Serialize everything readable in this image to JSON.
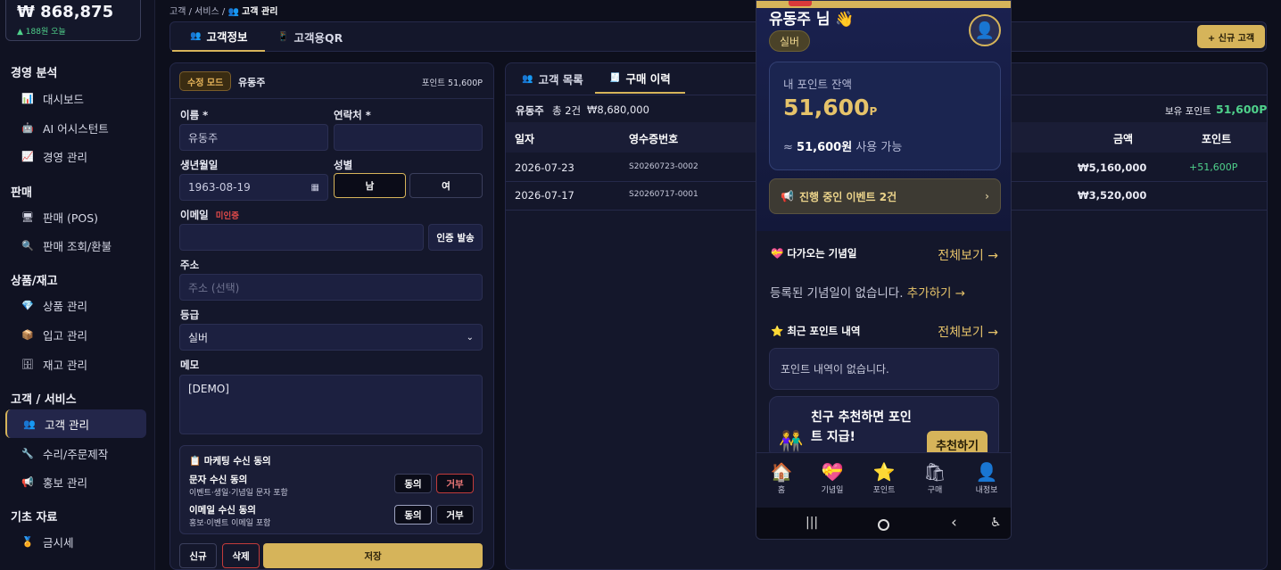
{
  "sidebar": {
    "sales_total": "₩ 868,875",
    "sales_delta": "▲ 188원 오늘",
    "sections": [
      {
        "title": "경영 분석",
        "items": [
          "대시보드",
          "AI 어시스턴트",
          "경영 관리"
        ]
      },
      {
        "title": "판매",
        "items": [
          "판매 (POS)",
          "판매 조회/환불"
        ]
      },
      {
        "title": "상품/재고",
        "items": [
          "상품 관리",
          "입고 관리",
          "재고 관리"
        ]
      },
      {
        "title": "고객 / 서비스",
        "items": [
          "고객 관리",
          "수리/주문제작",
          "홍보 관리"
        ]
      },
      {
        "title": "기초 자료",
        "items": [
          "금시세"
        ]
      }
    ],
    "active_item": "고객 관리"
  },
  "breadcrumb": {
    "parent": "고객 / 서비스 /",
    "current": "고객 관리"
  },
  "main_tabs": [
    "고객정보",
    "고객용QR"
  ],
  "new_customer_label": "+ 신규 고객",
  "form": {
    "mode_badge": "수정 모드",
    "customer_name": "유동주",
    "points_label": "포인트 51,600P",
    "name_label": "이름 *",
    "name_value": "유동주",
    "phone_label": "연락처 *",
    "phone_value": "",
    "birth_label": "생년월일",
    "birth_value": "1963-08-19",
    "gender_label": "성별",
    "gender_male": "남",
    "gender_female": "여",
    "email_label": "이메일",
    "email_status": "미인증",
    "verify_button": "인증 발송",
    "address_label": "주소",
    "address_placeholder": "주소 (선택)",
    "grade_label": "등급",
    "grade_value": "실버",
    "memo_label": "메모",
    "memo_value": "[DEMO]",
    "consent_title": "마케팅 수신 동의",
    "sms_title": "문자 수신 동의",
    "sms_sub": "이벤트·생일·기념일 문자 포함",
    "email_consent_title": "이메일 수신 동의",
    "email_consent_sub": "홍보·이벤트 이메일 포함",
    "agree": "동의",
    "reject": "거부",
    "btn_new": "신규",
    "btn_delete": "삭제",
    "btn_save": "저장"
  },
  "list": {
    "tabs": [
      "고객 목록",
      "구매 이력"
    ],
    "active_tab": "구매 이력",
    "summary_name": "유동주",
    "summary_count": "총 2건",
    "summary_amount": "₩8,680,000",
    "held_points_label": "보유 포인트",
    "held_points_value": "51,600P",
    "columns": [
      "일자",
      "영수증번호",
      "금액",
      "포인트"
    ],
    "rows": [
      {
        "date": "2026-07-23",
        "receipt": "S20260723-0002",
        "amount": "₩5,160,000",
        "points": "+51,600P"
      },
      {
        "date": "2026-07-17",
        "receipt": "S20260717-0001",
        "amount": "₩3,520,000",
        "points": ""
      }
    ]
  },
  "phone": {
    "greeting": "유동주 님 👋",
    "grade": "실버",
    "balance_label": "내 포인트 잔액",
    "balance_value": "51,600",
    "balance_unit": "P",
    "usable_prefix": "≈",
    "usable_value": "51,600원",
    "usable_suffix": "사용 가능",
    "event_text": "진행 중인 이벤트 2건",
    "anniv_title": "다가오는 기념일",
    "see_all": "전체보기 →",
    "anniv_empty": "등록된 기념일이 없습니다.",
    "anniv_add": "추가하기 →",
    "points_title": "최근 포인트 내역",
    "points_empty": "포인트 내역이 없습니다.",
    "referral_line1": "친구 추천하면 포인",
    "referral_line2": "트 지급!",
    "referral_button": "추천하기",
    "nav": [
      "홈",
      "기념일",
      "포인트",
      "구매",
      "내정보"
    ]
  },
  "colors": {
    "accent": "#d6b45a",
    "positive": "#4fd18b",
    "danger": "#d93a3a"
  }
}
